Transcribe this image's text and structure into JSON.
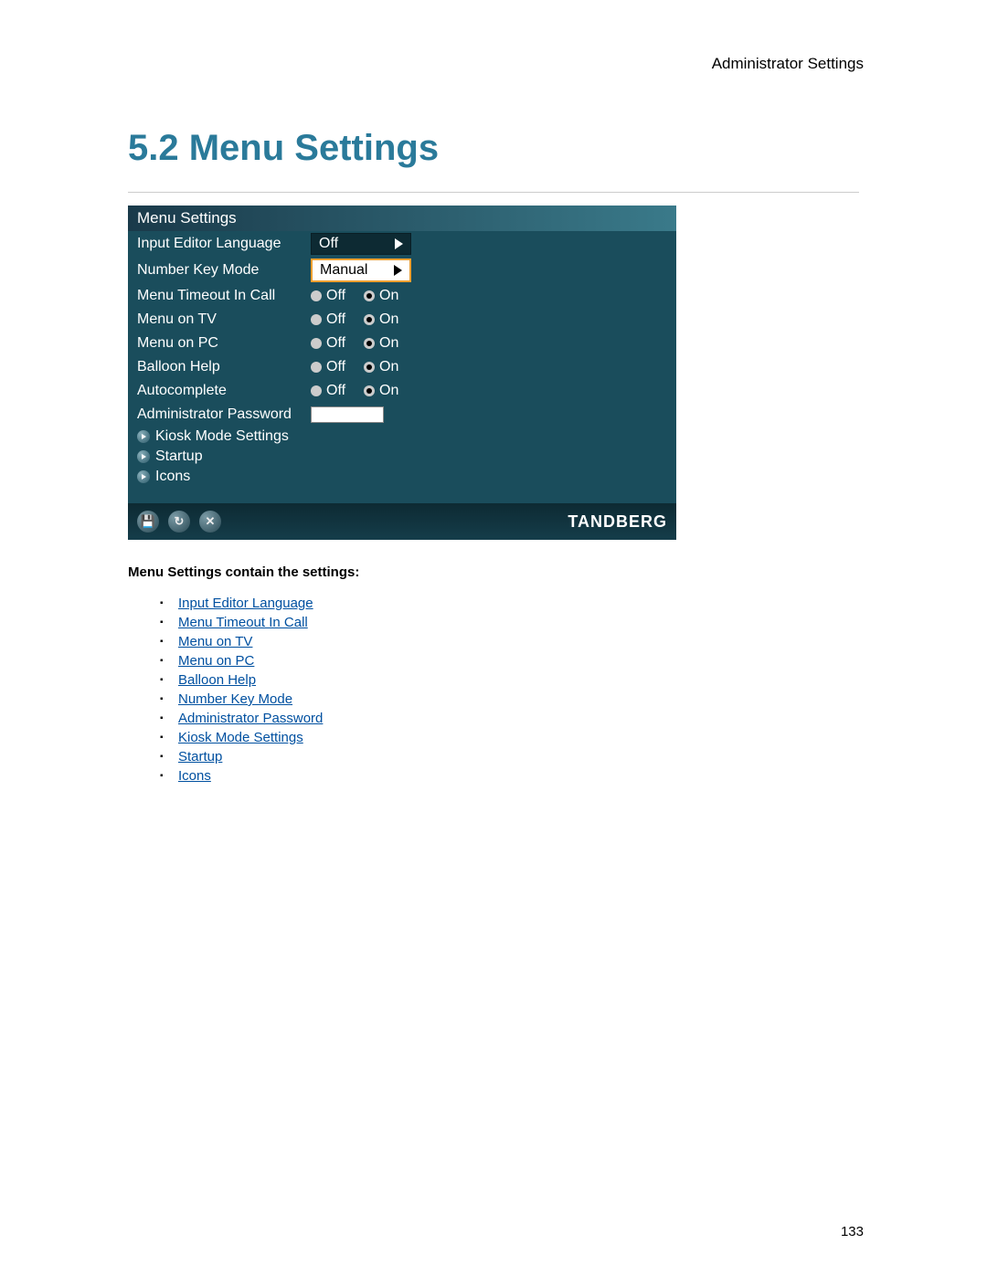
{
  "header": {
    "breadcrumb": "Administrator Settings"
  },
  "section": {
    "title": "5.2 Menu Settings"
  },
  "screenshot": {
    "title": "Menu Settings",
    "brand": "TANDBERG",
    "rows": {
      "input_editor": {
        "label": "Input Editor Language",
        "value": "Off"
      },
      "number_key": {
        "label": "Number Key Mode",
        "value": "Manual"
      },
      "menu_timeout": {
        "label": "Menu Timeout In Call",
        "off": "Off",
        "on": "On"
      },
      "menu_tv": {
        "label": "Menu on TV",
        "off": "Off",
        "on": "On"
      },
      "menu_pc": {
        "label": "Menu on PC",
        "off": "Off",
        "on": "On"
      },
      "balloon": {
        "label": "Balloon Help",
        "off": "Off",
        "on": "On"
      },
      "autocomplete": {
        "label": "Autocomplete",
        "off": "Off",
        "on": "On"
      },
      "admin_pw": {
        "label": "Administrator Password"
      }
    },
    "submenus": {
      "kiosk": "Kiosk Mode Settings",
      "startup": "Startup",
      "icons": "Icons"
    },
    "footer_icons": {
      "save": "💾",
      "refresh": "↻",
      "close": "✕"
    }
  },
  "content": {
    "subheading": "Menu Settings contain the settings:",
    "links": [
      "Input Editor Language",
      "Menu Timeout In Call",
      "Menu on TV",
      "Menu on PC",
      "Balloon Help",
      "Number Key Mode",
      "Administrator Password",
      "Kiosk Mode Settings",
      "Startup",
      "Icons"
    ]
  },
  "footer": {
    "page_number": "133"
  }
}
